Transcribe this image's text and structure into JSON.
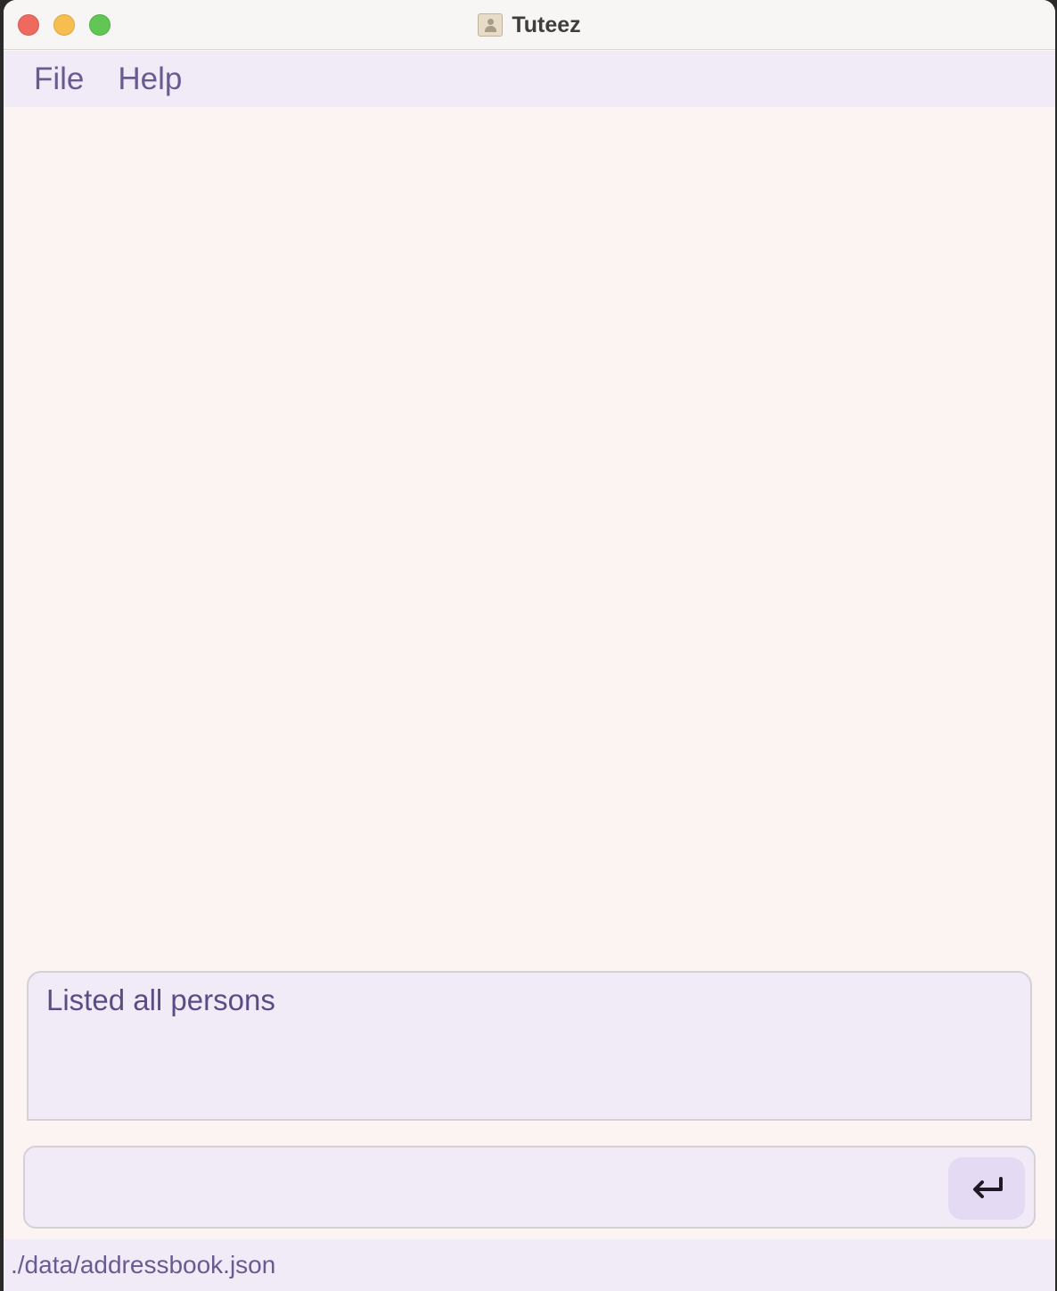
{
  "window": {
    "title": "Tuteez",
    "app_icon": "address-book-icon"
  },
  "menu": {
    "items": [
      {
        "label": "File"
      },
      {
        "label": "Help"
      }
    ]
  },
  "result": {
    "message": "Listed all persons"
  },
  "command": {
    "value": "",
    "submit_icon": "enter-return-icon"
  },
  "status": {
    "save_location": "./data/addressbook.json"
  },
  "colors": {
    "menu_background": "#f1ebf7",
    "content_background": "#fcf4f3",
    "menu_text": "#6a5a92",
    "result_text": "#5c4c86",
    "enter_button": "#e5daf4"
  }
}
